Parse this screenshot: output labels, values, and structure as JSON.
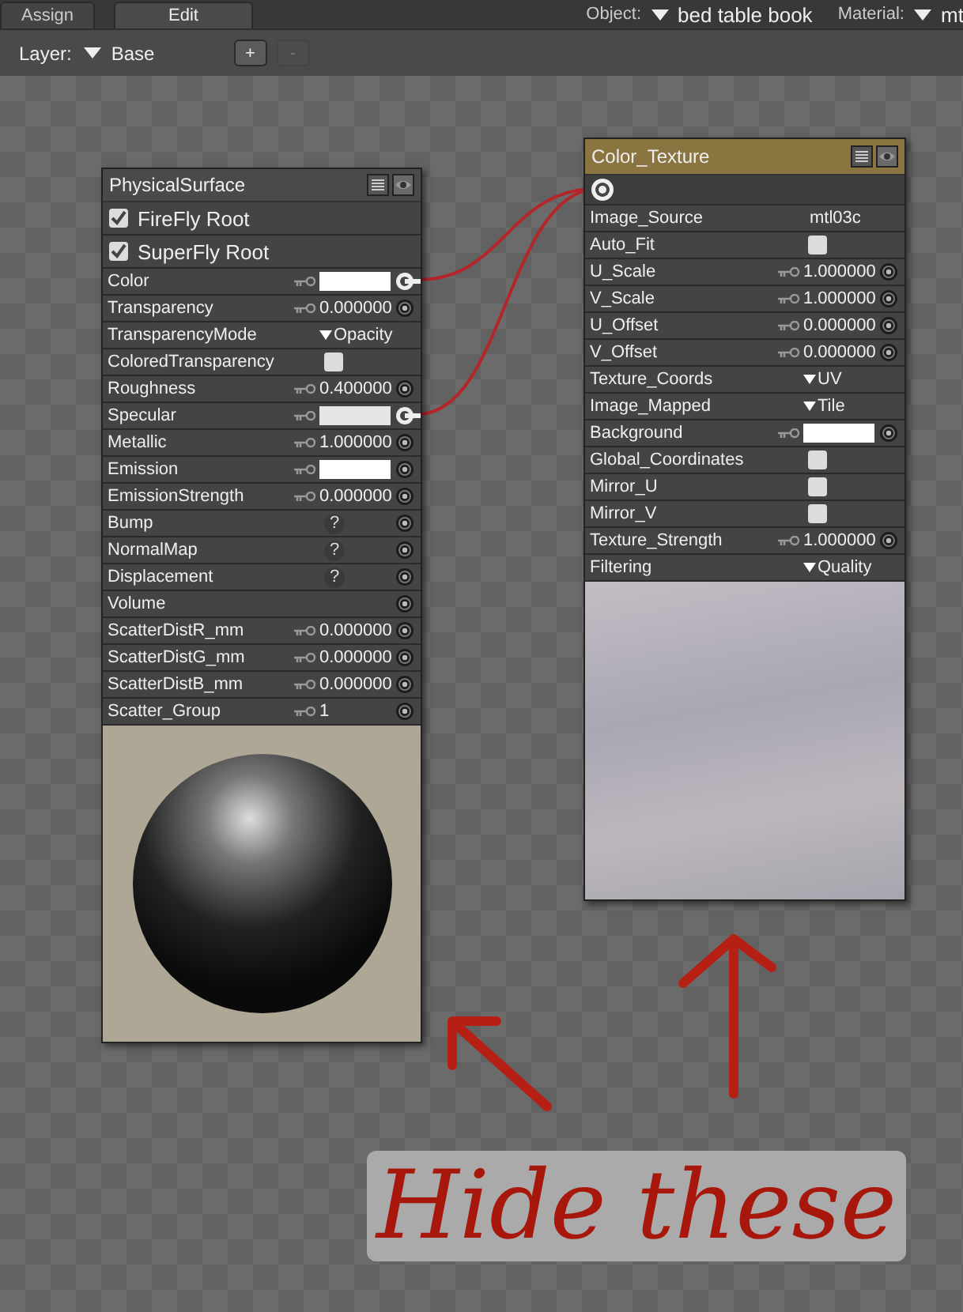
{
  "tabs": [
    {
      "label": "Assign",
      "selected": false
    },
    {
      "label": "Edit",
      "selected": true
    }
  ],
  "object": {
    "label": "Object:",
    "value": "bed table book"
  },
  "material": {
    "label": "Material:",
    "value": "mt"
  },
  "layer": {
    "label": "Layer:",
    "value": "Base"
  },
  "layer_buttons": [
    {
      "label": "+",
      "disabled": false
    },
    {
      "label": "-",
      "disabled": true
    }
  ],
  "nodes": [
    {
      "title": "PhysicalSurface",
      "kind": "root",
      "roots": [
        {
          "label": "FireFly Root",
          "checked": true
        },
        {
          "label": "SuperFly Root",
          "checked": true
        }
      ],
      "params": [
        {
          "name": "Color",
          "kind": "color",
          "color": "#ffffff",
          "connected": true
        },
        {
          "name": "Transparency",
          "kind": "number",
          "value": "0.000000"
        },
        {
          "name": "TransparencyMode",
          "kind": "menu",
          "value": "Opacity"
        },
        {
          "name": "ColoredTransparency",
          "kind": "checkbox",
          "checked": false
        },
        {
          "name": "Roughness",
          "kind": "number",
          "value": "0.400000"
        },
        {
          "name": "Specular",
          "kind": "color",
          "color": "#e6e6e6",
          "connected": true
        },
        {
          "name": "Metallic",
          "kind": "number",
          "value": "1.000000"
        },
        {
          "name": "Emission",
          "kind": "color",
          "color": "#ffffff",
          "connected": false
        },
        {
          "name": "EmissionStrength",
          "kind": "number",
          "value": "0.000000"
        },
        {
          "name": "Bump",
          "kind": "map",
          "value": "?"
        },
        {
          "name": "NormalMap",
          "kind": "map",
          "value": "?"
        },
        {
          "name": "Displacement",
          "kind": "map",
          "value": "?"
        },
        {
          "name": "Volume",
          "kind": "socket"
        },
        {
          "name": "ScatterDistR_mm",
          "kind": "number",
          "value": "0.000000"
        },
        {
          "name": "ScatterDistG_mm",
          "kind": "number",
          "value": "0.000000"
        },
        {
          "name": "ScatterDistB_mm",
          "kind": "number",
          "value": "0.000000"
        },
        {
          "name": "Scatter_Group",
          "kind": "number",
          "value": "1"
        }
      ]
    },
    {
      "title": "Color_Texture",
      "kind": "texture",
      "output_connected": true,
      "params": [
        {
          "name": "Image_Source",
          "kind": "text",
          "value": "mtl03c"
        },
        {
          "name": "Auto_Fit",
          "kind": "checkbox",
          "checked": false
        },
        {
          "name": "U_Scale",
          "kind": "number",
          "value": "1.000000"
        },
        {
          "name": "V_Scale",
          "kind": "number",
          "value": "1.000000"
        },
        {
          "name": "U_Offset",
          "kind": "number",
          "value": "0.000000"
        },
        {
          "name": "V_Offset",
          "kind": "number",
          "value": "0.000000"
        },
        {
          "name": "Texture_Coords",
          "kind": "menu",
          "value": "UV"
        },
        {
          "name": "Image_Mapped",
          "kind": "menu",
          "value": "Tile"
        },
        {
          "name": "Background",
          "kind": "color",
          "color": "#ffffff",
          "connected": false
        },
        {
          "name": "Global_Coordinates",
          "kind": "checkbox",
          "checked": false
        },
        {
          "name": "Mirror_U",
          "kind": "checkbox",
          "checked": false
        },
        {
          "name": "Mirror_V",
          "kind": "checkbox",
          "checked": false
        },
        {
          "name": "Texture_Strength",
          "kind": "number",
          "value": "1.000000"
        },
        {
          "name": "Filtering",
          "kind": "menu",
          "value": "Quality"
        }
      ]
    }
  ],
  "annotation": {
    "text": "Hide these"
  }
}
